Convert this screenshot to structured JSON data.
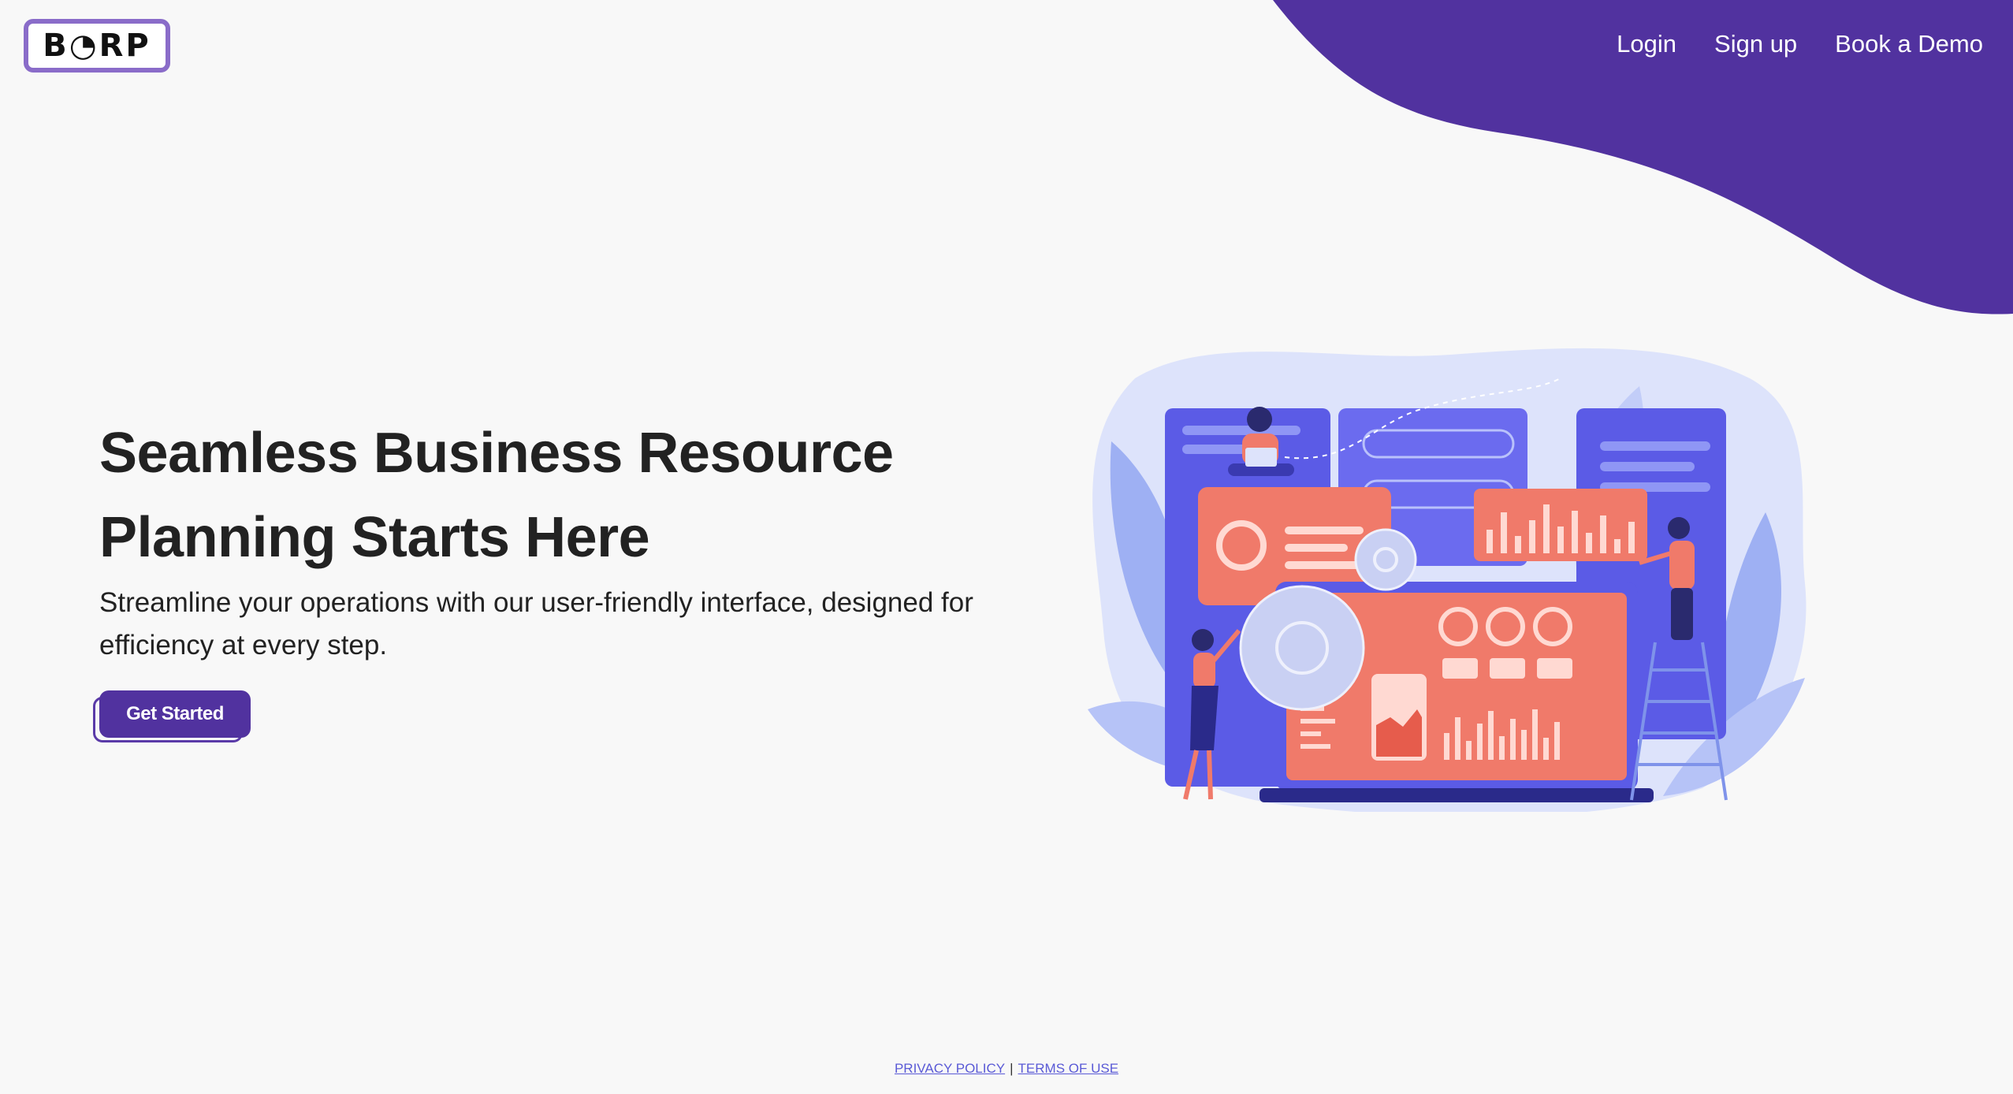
{
  "brand": {
    "logo_text": "B◔RP",
    "logo_border_color": "#8a6cc9"
  },
  "nav": {
    "login": "Login",
    "signup": "Sign up",
    "demo": "Book a Demo"
  },
  "hero": {
    "title": "Seamless Business Resource Planning Starts Here",
    "subtitle": "Streamline your operations with our user-friendly interface, designed for efficiency at every step.",
    "cta": "Get Started"
  },
  "footer": {
    "privacy": "PRIVACY POLICY",
    "separator": "|",
    "terms": "TERMS OF USE"
  },
  "colors": {
    "accent": "#51329f",
    "background": "#f8f8f8",
    "illustration_primary": "#5b5be6",
    "illustration_secondary": "#f07a6a"
  },
  "icons": {
    "illustration": "team-dashboard-illustration"
  }
}
